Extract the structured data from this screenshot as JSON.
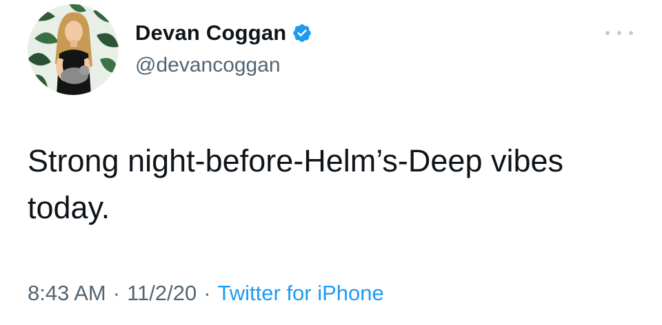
{
  "author": {
    "display_name": "Devan Coggan",
    "handle": "@devancoggan",
    "verified": true,
    "avatar_icon": "profile-photo"
  },
  "tweet": {
    "text": "Strong night-before-Helm’s-Deep vibes today.",
    "time": "8:43 AM",
    "date": "11/2/20",
    "separator": "·",
    "source": "Twitter for iPhone"
  },
  "icons": {
    "more": "more-options-icon",
    "verified": "verified-badge-icon"
  },
  "colors": {
    "text": "#0f1419",
    "secondary": "#536471",
    "link": "#1d9bf0",
    "verified": "#1d9bf0"
  }
}
